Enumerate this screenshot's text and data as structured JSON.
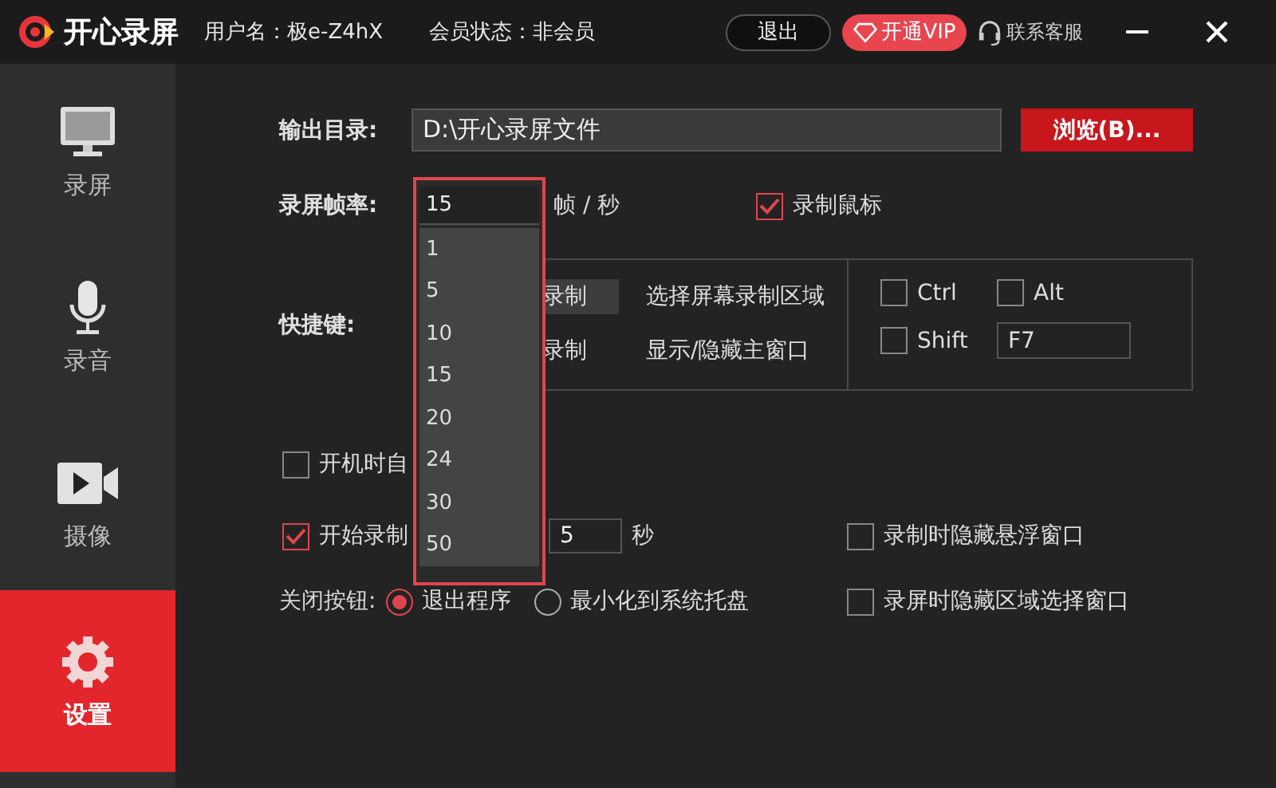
{
  "title_bar": {
    "app_name": "开心录屏",
    "user": "用户名：极e-Z4hX",
    "membership": "会员状态：非会员",
    "logout_button": "退出",
    "vip_button": "开通VIP",
    "support_link": "联系客服"
  },
  "sidebar": {
    "items": [
      {
        "label": "录屏",
        "kind": "monitor",
        "selected": false
      },
      {
        "label": "录音",
        "kind": "mic",
        "selected": false
      },
      {
        "label": "摄像",
        "kind": "camera",
        "selected": false
      },
      {
        "label": "设置",
        "kind": "gear",
        "selected": true
      }
    ]
  },
  "output_dir": {
    "label": "输出目录:",
    "value": "D:\\开心录屏文件",
    "browse_button": "浏览(B)..."
  },
  "frame_rate": {
    "label": "录屏帧率:",
    "unit": "帧 / 秒"
  },
  "record_cursor": {
    "label": "录制鼠标",
    "checked": true
  },
  "hotkeys": {
    "label": "快捷键:",
    "actions": [
      {
        "label": "录制",
        "selected": true
      },
      {
        "label": "选择屏幕录制区域",
        "selected": false
      },
      {
        "label": "录制",
        "selected": false
      },
      {
        "label": "显示/隐藏主窗口",
        "selected": false
      }
    ],
    "modifiers": [
      {
        "label": "Ctrl",
        "checked": false
      },
      {
        "label": "Alt",
        "checked": false
      },
      {
        "label": "Shift",
        "checked": false
      }
    ],
    "key": "F7"
  },
  "autostart": {
    "label": "开机时自",
    "checked": false
  },
  "countdown": {
    "label": "开始录制",
    "checked": true,
    "value": "5",
    "unit": "秒"
  },
  "hide_float": {
    "label": "录制时隐藏悬浮窗口",
    "checked": false
  },
  "close_button": {
    "label": "关闭按钮:",
    "options": [
      {
        "label": "退出程序",
        "selected": true
      },
      {
        "label": "最小化到系统托盘",
        "selected": false
      }
    ]
  },
  "hide_region": {
    "label": "录屏时隐藏区域选择窗口",
    "checked": false
  },
  "frame_rate_dropdown": {
    "value": "15",
    "options": [
      "1",
      "5",
      "10",
      "15",
      "20",
      "24",
      "30",
      "50"
    ]
  }
}
